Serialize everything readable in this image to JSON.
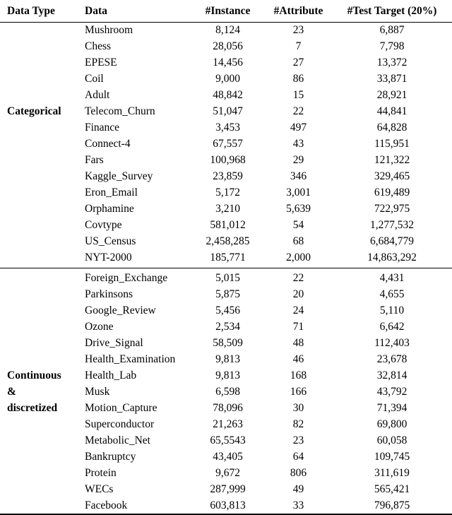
{
  "table": {
    "columns": [
      {
        "key": "data_type",
        "label": "Data Type",
        "align": "left"
      },
      {
        "key": "data",
        "label": "Data",
        "align": "left"
      },
      {
        "key": "instances",
        "label": "#Instance",
        "align": "center"
      },
      {
        "key": "attributes",
        "label": "#Attribute",
        "align": "center"
      },
      {
        "key": "test_target",
        "label": "#Test Target (20%)",
        "align": "center"
      }
    ],
    "sections": [
      {
        "type_label_lines": [
          "Categorical"
        ],
        "type_label_row_index": 5,
        "rows": [
          {
            "data": "Mushroom",
            "instances": "8,124",
            "attributes": "23",
            "test_target": "6,887"
          },
          {
            "data": "Chess",
            "instances": "28,056",
            "attributes": "7",
            "test_target": "7,798"
          },
          {
            "data": "EPESE",
            "instances": "14,456",
            "attributes": "27",
            "test_target": "13,372"
          },
          {
            "data": "Coil",
            "instances": "9,000",
            "attributes": "86",
            "test_target": "33,871"
          },
          {
            "data": "Adult",
            "instances": "48,842",
            "attributes": "15",
            "test_target": "28,921"
          },
          {
            "data": "Telecom_Churn",
            "instances": "51,047",
            "attributes": "22",
            "test_target": "44,841"
          },
          {
            "data": "Finance",
            "instances": "3,453",
            "attributes": "497",
            "test_target": "64,828"
          },
          {
            "data": "Connect-4",
            "instances": "67,557",
            "attributes": "43",
            "test_target": "115,951"
          },
          {
            "data": "Fars",
            "instances": "100,968",
            "attributes": "29",
            "test_target": "121,322"
          },
          {
            "data": "Kaggle_Survey",
            "instances": "23,859",
            "attributes": "346",
            "test_target": "329,465"
          },
          {
            "data": "Eron_Email",
            "instances": "5,172",
            "attributes": "3,001",
            "test_target": "619,489"
          },
          {
            "data": "Orphamine",
            "instances": "3,210",
            "attributes": "5,639",
            "test_target": "722,975"
          },
          {
            "data": "Covtype",
            "instances": "581,012",
            "attributes": "54",
            "test_target": "1,277,532"
          },
          {
            "data": "US_Census",
            "instances": "2,458,285",
            "attributes": "68",
            "test_target": "6,684,779"
          },
          {
            "data": "NYT-2000",
            "instances": "185,771",
            "attributes": "2,000",
            "test_target": "14,863,292"
          }
        ]
      },
      {
        "type_label_lines": [
          "Continuous",
          "&",
          "discretized"
        ],
        "type_label_row_index": 6,
        "rows": [
          {
            "data": "Foreign_Exchange",
            "instances": "5,015",
            "attributes": "22",
            "test_target": "4,431"
          },
          {
            "data": "Parkinsons",
            "instances": "5,875",
            "attributes": "20",
            "test_target": "4,655"
          },
          {
            "data": "Google_Review",
            "instances": "5,456",
            "attributes": "24",
            "test_target": "5,110"
          },
          {
            "data": "Ozone",
            "instances": "2,534",
            "attributes": "71",
            "test_target": "6,642"
          },
          {
            "data": "Drive_Signal",
            "instances": "58,509",
            "attributes": "48",
            "test_target": "112,403"
          },
          {
            "data": "Health_Examination",
            "instances": "9,813",
            "attributes": "46",
            "test_target": "23,678"
          },
          {
            "data": "Health_Lab",
            "instances": "9,813",
            "attributes": "168",
            "test_target": "32,814"
          },
          {
            "data": "Musk",
            "instances": "6,598",
            "attributes": "166",
            "test_target": "43,792"
          },
          {
            "data": "Motion_Capture",
            "instances": "78,096",
            "attributes": "30",
            "test_target": "71,394"
          },
          {
            "data": "Superconductor",
            "instances": "21,263",
            "attributes": "82",
            "test_target": "69,800"
          },
          {
            "data": "Metabolic_Net",
            "instances": "65,5543",
            "attributes": "23",
            "test_target": "60,058"
          },
          {
            "data": "Bankruptcy",
            "instances": "43,405",
            "attributes": "64",
            "test_target": "109,745"
          },
          {
            "data": "Protein",
            "instances": "9,672",
            "attributes": "806",
            "test_target": "311,619"
          },
          {
            "data": "WECs",
            "instances": "287,999",
            "attributes": "49",
            "test_target": "565,421"
          },
          {
            "data": "Facebook",
            "instances": "603,813",
            "attributes": "33",
            "test_target": "796,875"
          }
        ]
      }
    ]
  }
}
